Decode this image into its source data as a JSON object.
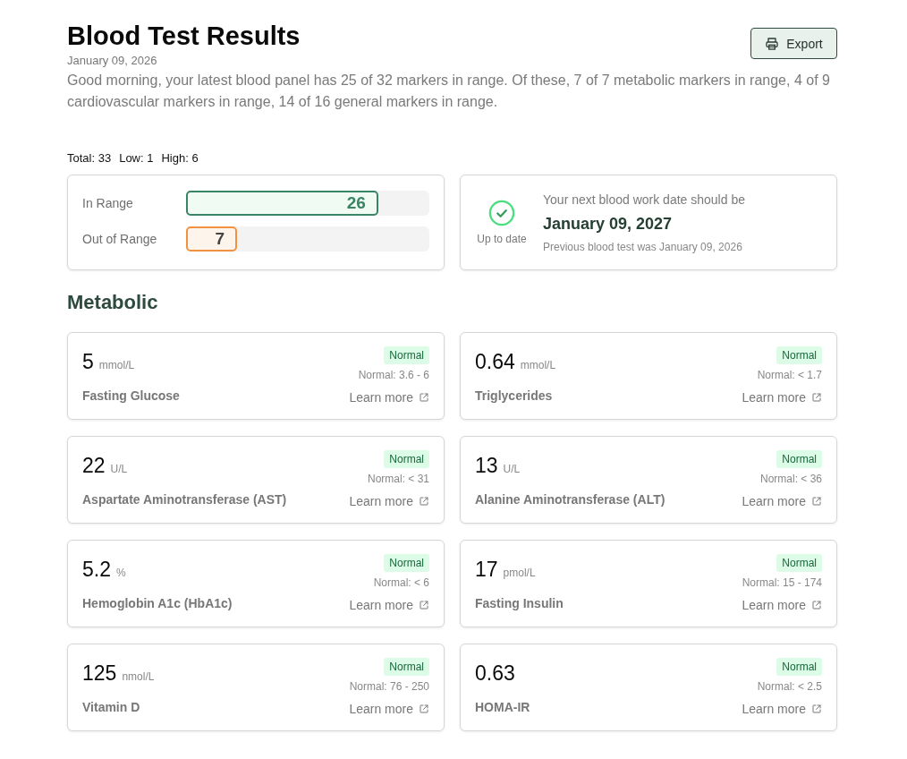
{
  "header": {
    "title": "Blood Test Results",
    "date": "January 09, 2026",
    "summary": "Good morning, your latest blood panel has 25 of 32 markers in range. Of these, 7 of 7 metabolic markers in range, 4 of 9 cardiovascular markers in range, 14 of 16 general markers in range.",
    "export_button": "Export"
  },
  "totals": [
    "Total: 33",
    "Low: 1",
    "High: 6"
  ],
  "range_summary": {
    "bars": [
      {
        "label": "In Range",
        "count": "26",
        "level": 0.79,
        "kind": "in_range"
      },
      {
        "label": "Out of Range",
        "count": "7",
        "level": 0.21,
        "kind": "out_of_range"
      }
    ]
  },
  "schedule": {
    "status": "Up to date",
    "kind": "up_to_date",
    "heading": "Your next blood work date should be",
    "next_date": "January 09, 2027",
    "previous": "Previous blood test was January 09, 2026"
  },
  "sections": [
    {
      "title": "Metabolic",
      "markers": [
        {
          "value": "5",
          "unit": "mmol/L",
          "name": "Fasting Glucose",
          "badge": {
            "label": "Normal",
            "kind": "normal"
          },
          "range": "Normal: 3.6 - 6",
          "link": "Learn more"
        },
        {
          "value": "0.64",
          "unit": "mmol/L",
          "name": "Triglycerides",
          "badge": {
            "label": "Normal",
            "kind": "normal"
          },
          "range": "Normal: < 1.7",
          "link": "Learn more"
        },
        {
          "value": "22",
          "unit": "U/L",
          "name": "Aspartate Aminotransferase (AST)",
          "badge": {
            "label": "Normal",
            "kind": "normal"
          },
          "range": "Normal: < 31",
          "link": "Learn more"
        },
        {
          "value": "13",
          "unit": "U/L",
          "name": "Alanine Aminotransferase (ALT)",
          "badge": {
            "label": "Normal",
            "kind": "normal"
          },
          "range": "Normal: < 36",
          "link": "Learn more"
        },
        {
          "value": "5.2",
          "unit": "%",
          "name": "Hemoglobin A1c (HbA1c)",
          "badge": {
            "label": "Normal",
            "kind": "normal"
          },
          "range": "Normal: < 6",
          "link": "Learn more"
        },
        {
          "value": "17",
          "unit": "pmol/L",
          "name": "Fasting Insulin",
          "badge": {
            "label": "Normal",
            "kind": "normal"
          },
          "range": "Normal: 15 - 174",
          "link": "Learn more"
        },
        {
          "value": "125",
          "unit": "nmol/L",
          "name": "Vitamin D",
          "badge": {
            "label": "Normal",
            "kind": "normal"
          },
          "range": "Normal: 76 - 250",
          "link": "Learn more"
        },
        {
          "value": "0.63",
          "name": "HOMA-IR",
          "badge": {
            "label": "Normal",
            "kind": "normal"
          },
          "range": "Normal: < 2.5",
          "link": "Learn more"
        }
      ]
    }
  ]
}
